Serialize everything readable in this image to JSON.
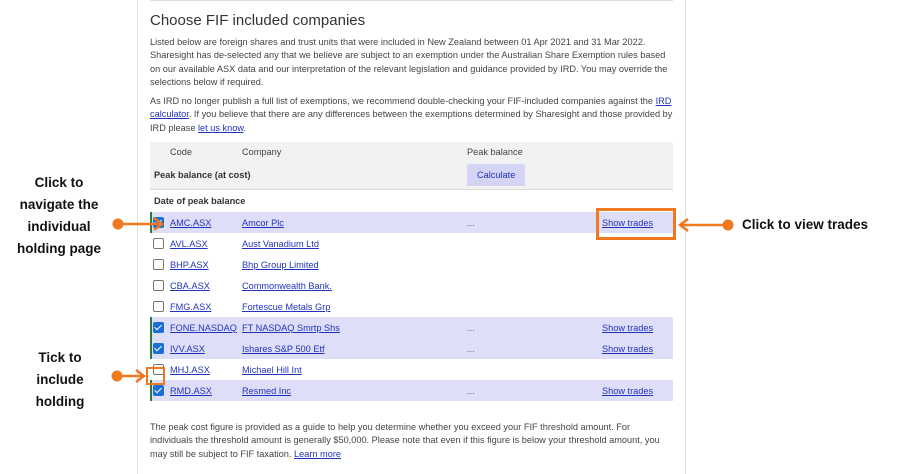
{
  "section": {
    "title": "Choose FIF included companies",
    "para1": "Listed below are foreign shares and trust units that were included in New Zealand between 01 Apr 2021 and 31 Mar 2022. Sharesight has de-selected any that we believe are subject to an exemption under the Australian Share Exemption rules based on our available ASX data and our interpretation of the relevant legislation and guidance provided by IRD. You may override the selections below if required.",
    "para2_a": "As IRD no longer publish a full list of exemptions, we recommend double-checking your FIF-included companies against the ",
    "para2_link1": "IRD calculator",
    "para2_b": ". If you believe that there are any differences between the exemptions determined by Sharesight and those provided by IRD please ",
    "para2_link2": "let us know",
    "para2_c": ".",
    "footer_a": "The peak cost figure is provided as a guide to help you determine whether you exceed your FIF threshold amount. For individuals the threshold amount is generally $50,000. Please note that even if this figure is below your threshold amount, you may still be subject to FIF taxation. ",
    "footer_link": "Learn more"
  },
  "table": {
    "col_code": "Code",
    "col_company": "Company",
    "col_peak": "Peak balance",
    "peak_label": "Peak balance (at cost)",
    "calculate_label": "Calculate",
    "date_label": "Date of peak balance",
    "rows": [
      {
        "code": "AMC.ASX",
        "company": "Amcor Plc",
        "peak": "...",
        "action": "Show trades",
        "checked": true
      },
      {
        "code": "AVL.ASX",
        "company": "Aust Vanadium Ltd",
        "peak": "",
        "action": "",
        "checked": false
      },
      {
        "code": "BHP.ASX",
        "company": "Bhp Group Limited",
        "peak": "",
        "action": "",
        "checked": false
      },
      {
        "code": "CBA.ASX",
        "company": "Commonwealth Bank.",
        "peak": "",
        "action": "",
        "checked": false
      },
      {
        "code": "FMG.ASX",
        "company": "Fortescue Metals Grp",
        "peak": "",
        "action": "",
        "checked": false
      },
      {
        "code": "FONE.NASDAQ",
        "company": "FT NASDAQ Smrtp Shs",
        "peak": "...",
        "action": "Show trades",
        "checked": true
      },
      {
        "code": "IVV.ASX",
        "company": "Ishares S&P 500 Etf",
        "peak": "...",
        "action": "Show trades",
        "checked": true
      },
      {
        "code": "MHJ.ASX",
        "company": "Michael Hill Int",
        "peak": "",
        "action": "",
        "checked": false
      },
      {
        "code": "RMD.ASX",
        "company": "Resmed Inc",
        "peak": "...",
        "action": "Show trades",
        "checked": true
      }
    ]
  },
  "annotations": {
    "navigate": [
      "Click to",
      "navigate the",
      "individual",
      "holding page"
    ],
    "trades": "Click to view trades",
    "tick": [
      "Tick to",
      "include",
      "holding"
    ]
  },
  "colors": {
    "accent": "#f07820",
    "selected_row": "#dedef8",
    "link": "#2233bb",
    "checkbox": "#1a6fd6"
  }
}
